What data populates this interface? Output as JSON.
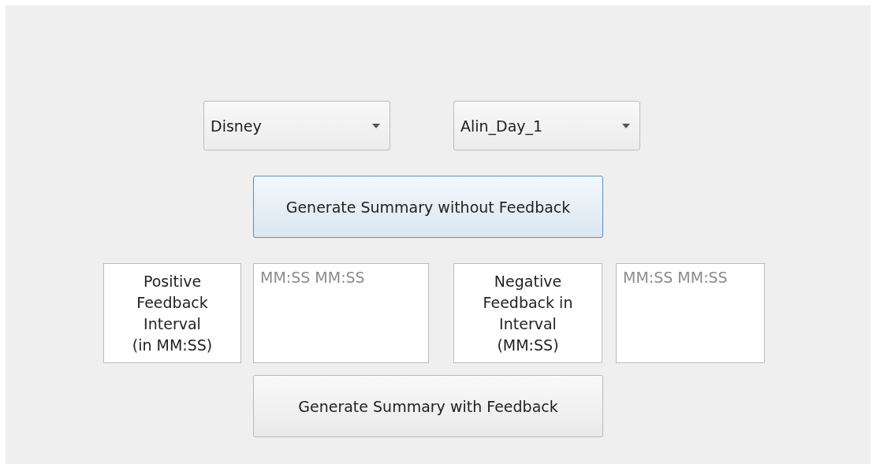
{
  "dropdowns": [
    {
      "value": "Disney"
    },
    {
      "value": "Alin_Day_1"
    }
  ],
  "generate_without_button": {
    "label": "Generate Summary without Feedback",
    "focused": true
  },
  "positive": {
    "label": "Positive\nFeedback\nInterval\n(in MM:SS)",
    "placeholder": "MM:SS MM:SS"
  },
  "negative": {
    "label": "Negative\nFeedback in\nInterval\n(MM:SS)",
    "placeholder": "MM:SS MM:SS"
  },
  "generate_with_button": {
    "label": "Generate Summary with Feedback",
    "focused": false
  }
}
